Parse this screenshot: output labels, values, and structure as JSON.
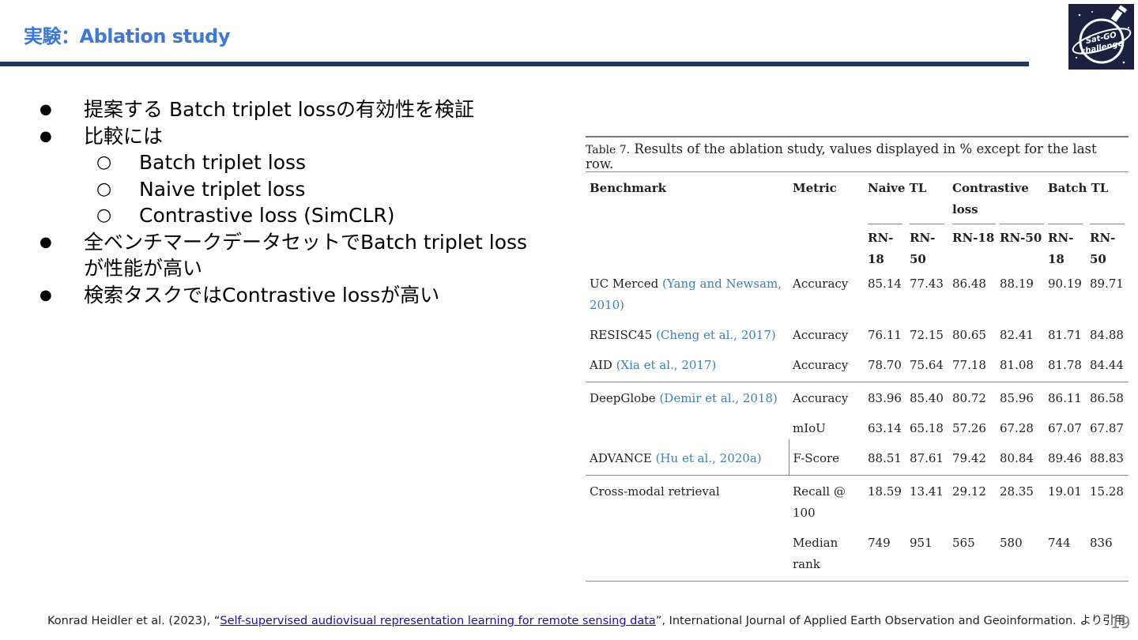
{
  "slide": {
    "title": "実験：Ablation study",
    "page_number": "19",
    "logo_text": "Sat-GO challenge",
    "bullets": [
      {
        "type": "main",
        "marker": "●",
        "text": "提案する Batch triplet lossの有効性を検証"
      },
      {
        "type": "main",
        "marker": "●",
        "text": "比較には"
      },
      {
        "type": "sub",
        "marker": "○",
        "text": "Batch triplet loss"
      },
      {
        "type": "sub",
        "marker": "○",
        "text": "Naive triplet loss"
      },
      {
        "type": "sub",
        "marker": "○",
        "text": "Contrastive loss (SimCLR)"
      },
      {
        "type": "main",
        "marker": "●",
        "text": "全ベンチマークデータセットでBatch triplet loss が性能が高い"
      },
      {
        "type": "main",
        "marker": "●",
        "text": "検索タスクではContrastive lossが高い"
      }
    ]
  },
  "table": {
    "caption_label": "Table 7.",
    "caption_text": "Results of the ablation study, values displayed in % except for the last row.",
    "headers": {
      "benchmark": "Benchmark",
      "metric": "Metric",
      "naive": "Naive TL",
      "contrastive": "Contrastive loss",
      "batch": "Batch TL",
      "rn18": "RN-18",
      "rn50": "RN-50"
    },
    "rows": [
      {
        "benchmark": "UC Merced",
        "cite": "(Yang and Newsam, 2010)",
        "metric": "Accuracy",
        "values": [
          "85.14",
          "77.43",
          "86.48",
          "88.19",
          "90.19",
          "89.71"
        ]
      },
      {
        "benchmark": "RESISC45",
        "cite": "(Cheng et al., 2017)",
        "metric": "Accuracy",
        "values": [
          "76.11",
          "72.15",
          "80.65",
          "82.41",
          "81.71",
          "84.88"
        ]
      },
      {
        "benchmark": "AID",
        "cite": "(Xia et al., 2017)",
        "metric": "Accuracy",
        "values": [
          "78.70",
          "75.64",
          "77.18",
          "81.08",
          "81.78",
          "84.44"
        ]
      },
      {
        "benchmark": "DeepGlobe",
        "cite": "(Demir et al., 2018)",
        "metric": "Accuracy",
        "values": [
          "83.96",
          "85.40",
          "80.72",
          "85.96",
          "86.11",
          "86.58"
        ]
      },
      {
        "benchmark": "",
        "cite": "",
        "metric": "mIoU",
        "values": [
          "63.14",
          "65.18",
          "57.26",
          "67.28",
          "67.07",
          "67.87"
        ]
      },
      {
        "benchmark": "ADVANCE",
        "cite": "(Hu et al., 2020a)",
        "metric": "F-Score",
        "values": [
          "88.51",
          "87.61",
          "79.42",
          "80.84",
          "89.46",
          "88.83"
        ]
      },
      {
        "benchmark": "Cross-modal retrieval",
        "cite": "",
        "metric": "Recall @ 100",
        "values": [
          "18.59",
          "13.41",
          "29.12",
          "28.35",
          "19.01",
          "15.28"
        ]
      },
      {
        "benchmark": "",
        "cite": "",
        "metric": "Median rank",
        "values": [
          "749",
          "951",
          "565",
          "580",
          "744",
          "836"
        ]
      }
    ]
  },
  "footer": {
    "prefix": "Konrad Heidler et al. (2023), “",
    "link_text": "Self-supervised audiovisual representation learning for remote sensing data",
    "suffix": "”, International Journal of Applied Earth Observation and Geoinformation. より引用"
  },
  "colors": {
    "title": "#3c78d8",
    "rule": "#1f3a5c",
    "citation": "#3b7fb8",
    "link": "#1a0dab",
    "logo_bg": "#1c2140"
  }
}
